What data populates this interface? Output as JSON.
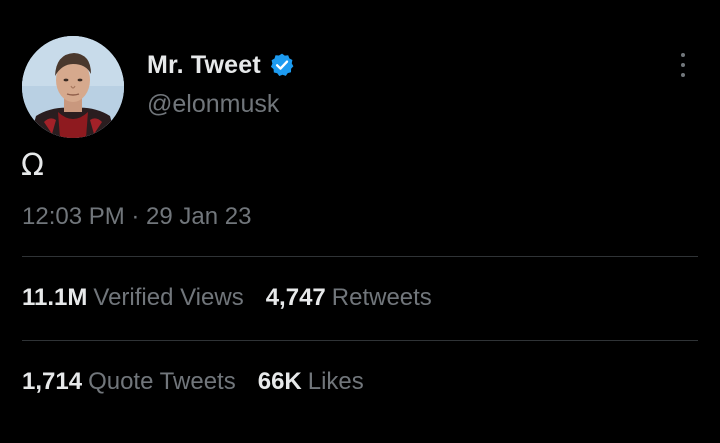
{
  "tweet": {
    "author": {
      "display_name": "Mr. Tweet",
      "handle": "@elonmusk",
      "verified": true,
      "verified_color": "#1d9bf0"
    },
    "text": "Ω",
    "timestamp": "12:03 PM · 29 Jan 23",
    "stats": [
      {
        "value": "11.1M",
        "label": "Verified Views"
      },
      {
        "value": "4,747",
        "label": "Retweets"
      },
      {
        "value": "1,714",
        "label": "Quote Tweets"
      },
      {
        "value": "66K",
        "label": "Likes"
      }
    ]
  },
  "colors": {
    "background": "#000000",
    "primary_text": "#e7e9ea",
    "secondary_text": "#71767b",
    "divider": "#2f3336"
  },
  "icons": {
    "verified": "verified-badge-icon",
    "more": "more-options-icon"
  }
}
